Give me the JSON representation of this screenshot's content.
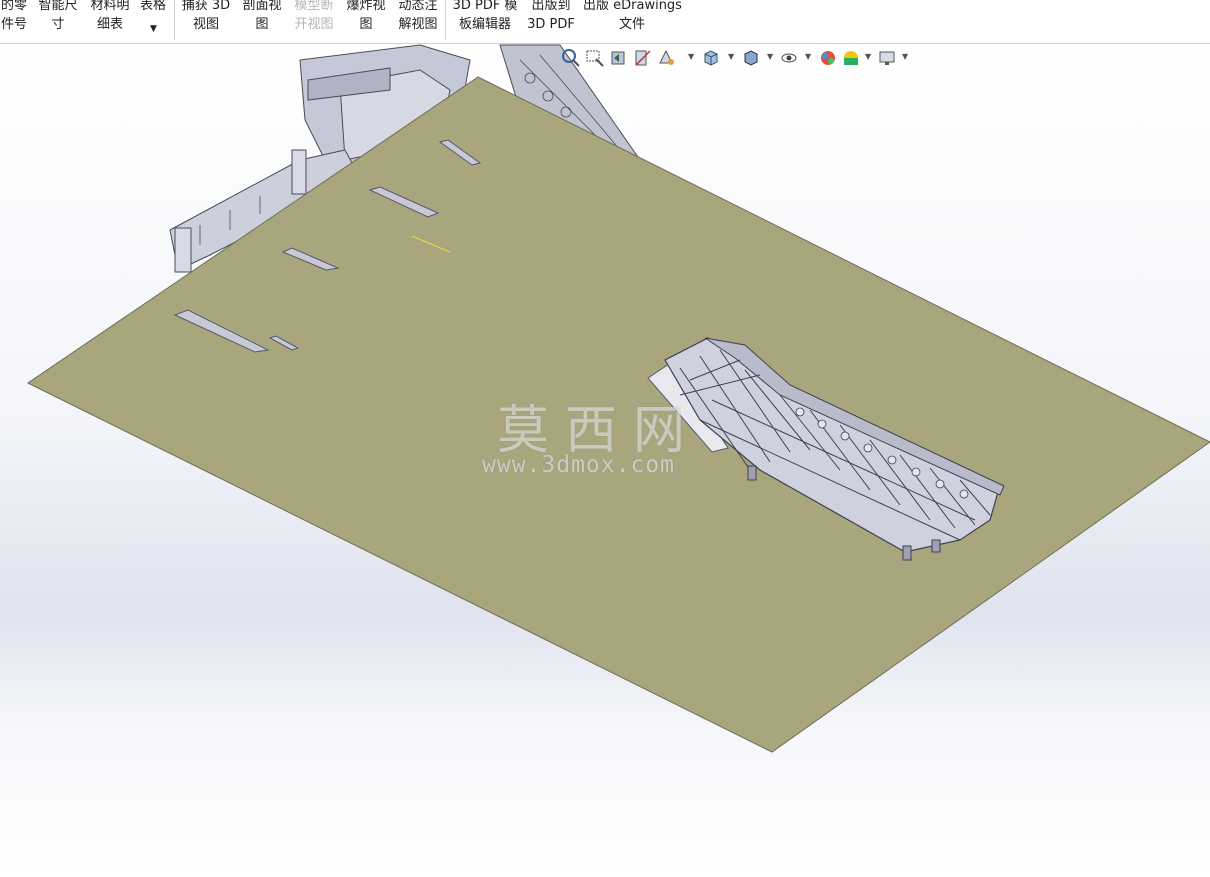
{
  "ribbon": {
    "buttons": [
      {
        "line1": "的零",
        "line2": "件号",
        "state": "enabled"
      },
      {
        "line1": "智能尺",
        "line2": "寸",
        "state": "enabled"
      },
      {
        "line1": "材料明",
        "line2": "细表",
        "state": "enabled"
      },
      {
        "line1": "表格",
        "line2": "",
        "state": "enabled"
      },
      {
        "line1": "捕获 3D",
        "line2": "视图",
        "state": "enabled"
      },
      {
        "line1": "剖面视",
        "line2": "图",
        "state": "enabled"
      },
      {
        "line1": "模型断",
        "line2": "开视图",
        "state": "disabled"
      },
      {
        "line1": "爆炸视",
        "line2": "图",
        "state": "enabled"
      },
      {
        "line1": "动态注",
        "line2": "解视图",
        "state": "enabled"
      },
      {
        "line1": "3D PDF 模",
        "line2": "板编辑器",
        "state": "enabled"
      },
      {
        "line1": "出版到",
        "line2": "3D PDF",
        "state": "enabled"
      },
      {
        "line1": "出版 eDrawings",
        "line2": "文件",
        "state": "enabled"
      }
    ]
  },
  "heads_up_toolbar": {
    "icons": [
      "zoom-fit-icon",
      "zoom-area-icon",
      "previous-view-icon",
      "section-view-icon",
      "dynamic-annotation-icon",
      "view-orientation-icon",
      "display-style-icon",
      "hide-show-items-icon",
      "edit-appearance-icon",
      "apply-scene-icon",
      "view-settings-icon"
    ]
  },
  "watermark": {
    "title": "莫西网",
    "url": "www.3dmox.com"
  },
  "colors": {
    "ground_plate": "#a9a67e",
    "plate_edge": "#6f6d52",
    "steel": "#c9ccd8",
    "steel_dark": "#4a4c58",
    "viewport_band": "#dfe3ee"
  }
}
